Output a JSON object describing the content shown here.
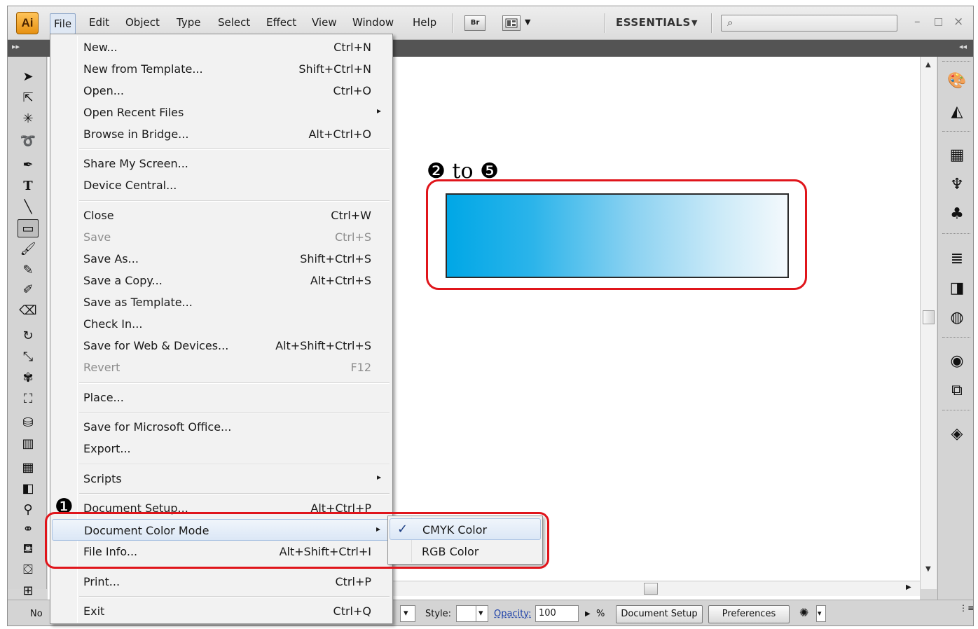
{
  "app": {
    "logo": "Ai",
    "menu": [
      "File",
      "Edit",
      "Object",
      "Type",
      "Select",
      "Effect",
      "View",
      "Window",
      "Help"
    ],
    "bridge_label": "Br",
    "workspace": "ESSENTIALS",
    "workspace_arrow": "▼",
    "search_icon": "⌕",
    "window_controls": [
      "–",
      "□",
      "×"
    ],
    "panel_collapse_left": "▸▸",
    "panel_collapse_right": "◂◂"
  },
  "file_menu": {
    "items": [
      {
        "label": "New...",
        "shortcut": "Ctrl+N"
      },
      {
        "label": "New from Template...",
        "shortcut": "Shift+Ctrl+N"
      },
      {
        "label": "Open...",
        "shortcut": "Ctrl+O"
      },
      {
        "label": "Open Recent Files",
        "shortcut": "",
        "submenu": "▸"
      },
      {
        "label": "Browse in Bridge...",
        "shortcut": "Alt+Ctrl+O"
      },
      {
        "label": "Share My Screen...",
        "shortcut": ""
      },
      {
        "label": "Device Central...",
        "shortcut": ""
      },
      {
        "label": "Close",
        "shortcut": "Ctrl+W"
      },
      {
        "label": "Save",
        "shortcut": "Ctrl+S"
      },
      {
        "label": "Save As...",
        "shortcut": "Shift+Ctrl+S"
      },
      {
        "label": "Save a Copy...",
        "shortcut": "Alt+Ctrl+S"
      },
      {
        "label": "Save as Template...",
        "shortcut": ""
      },
      {
        "label": "Check In...",
        "shortcut": ""
      },
      {
        "label": "Save for Web & Devices...",
        "shortcut": "Alt+Shift+Ctrl+S"
      },
      {
        "label": "Revert",
        "shortcut": "F12"
      },
      {
        "label": "Place...",
        "shortcut": ""
      },
      {
        "label": "Save for Microsoft Office...",
        "shortcut": ""
      },
      {
        "label": "Export...",
        "shortcut": ""
      },
      {
        "label": "Scripts",
        "shortcut": "",
        "submenu": "▸"
      },
      {
        "label": "Document Setup...",
        "shortcut": "Alt+Ctrl+P"
      },
      {
        "label": "Document Color Mode",
        "shortcut": "",
        "submenu": "▸"
      },
      {
        "label": "File Info...",
        "shortcut": "Alt+Shift+Ctrl+I"
      },
      {
        "label": "Print...",
        "shortcut": "Ctrl+P"
      },
      {
        "label": "Exit",
        "shortcut": "Ctrl+Q"
      }
    ]
  },
  "color_mode_submenu": {
    "check": "✓",
    "items": [
      "CMYK Color",
      "RGB Color"
    ]
  },
  "annotations": {
    "step1": "❶",
    "step_range": "❷ to ❺"
  },
  "statusbar": {
    "left_text": "No",
    "style_label": "Style:",
    "opacity_label": "Opacity:",
    "opacity_value": "100",
    "percent": "%",
    "document_setup_button": "Document Setup",
    "preferences_button": "Preferences"
  },
  "colors": {
    "gradient_start": "#00a7e6",
    "gradient_end": "#f4f9fc",
    "highlight": "#e0151b"
  }
}
